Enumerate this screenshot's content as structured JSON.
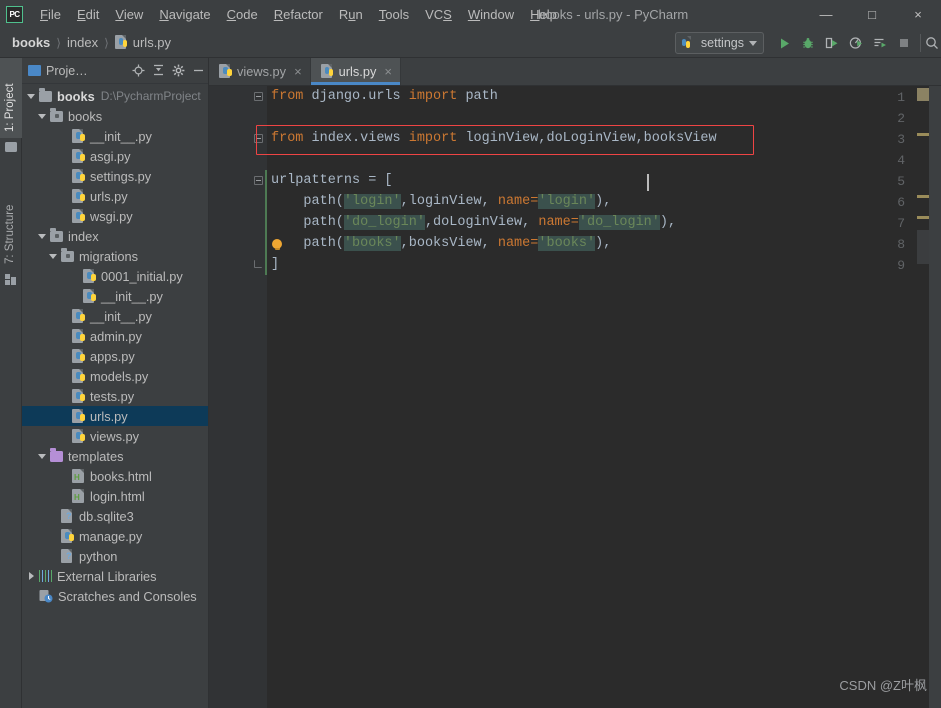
{
  "window": {
    "title": "books - urls.py - PyCharm",
    "app_logo": "pycharm-logo",
    "controls": {
      "minimize": "—",
      "maximize": "□",
      "close": "×"
    }
  },
  "menu": {
    "items": [
      {
        "label": "File",
        "mnemonic": "F"
      },
      {
        "label": "Edit",
        "mnemonic": "E"
      },
      {
        "label": "View",
        "mnemonic": "V"
      },
      {
        "label": "Navigate",
        "mnemonic": "N"
      },
      {
        "label": "Code",
        "mnemonic": "C"
      },
      {
        "label": "Refactor",
        "mnemonic": "R"
      },
      {
        "label": "Run",
        "mnemonic": "u"
      },
      {
        "label": "Tools",
        "mnemonic": "T"
      },
      {
        "label": "VCS",
        "mnemonic": "S"
      },
      {
        "label": "Window",
        "mnemonic": "W"
      },
      {
        "label": "Help",
        "mnemonic": "H"
      }
    ]
  },
  "navbar": {
    "breadcrumbs": [
      {
        "label": "books",
        "bold": true,
        "icon": ""
      },
      {
        "label": "index",
        "bold": false,
        "icon": ""
      },
      {
        "label": "urls.py",
        "bold": false,
        "icon": "python-file-icon"
      }
    ],
    "separator": "〉",
    "run_config": {
      "label": "settings",
      "icon": "python-icon",
      "caret": "chevron-down-icon"
    },
    "buttons": [
      {
        "name": "run-button",
        "icon": "run-icon"
      },
      {
        "name": "debug-button",
        "icon": "debug-bug-icon"
      },
      {
        "name": "run-coverage-button",
        "icon": "coverage-icon"
      },
      {
        "name": "profile-button",
        "icon": "profiler-icon"
      },
      {
        "name": "run-with-console-button",
        "icon": "run-console-icon"
      },
      {
        "name": "stop-button",
        "icon": "stop-square-icon"
      },
      {
        "name": "search-everywhere-button",
        "icon": "search-icon"
      }
    ]
  },
  "left_strip": {
    "tabs": [
      {
        "label": "1: Project",
        "active": true,
        "icon": "project-folder-icon"
      },
      {
        "label": "7: Structure",
        "active": false,
        "icon": "structure-icon"
      }
    ]
  },
  "project_panel": {
    "title": "Proje",
    "title_truncated": "Proje…",
    "header_icons": [
      {
        "name": "select-opened-file-icon",
        "glyph": "target-icon"
      },
      {
        "name": "collapse-all-icon",
        "glyph": "collapse-icon"
      },
      {
        "name": "settings-gear-icon",
        "glyph": "gear-icon"
      },
      {
        "name": "hide-panel-icon",
        "glyph": "minus-icon"
      }
    ],
    "tree": [
      {
        "label": "books",
        "detail": "D:\\PycharmProject",
        "depth": 0,
        "icon": "folder-icon",
        "arrow": "down",
        "bold": true,
        "selected": false
      },
      {
        "label": "books",
        "detail": "",
        "depth": 1,
        "icon": "package-folder-icon",
        "arrow": "down",
        "bold": false,
        "selected": false
      },
      {
        "label": "__init__.py",
        "detail": "",
        "depth": 3,
        "icon": "python-file-icon",
        "arrow": "",
        "bold": false,
        "selected": false
      },
      {
        "label": "asgi.py",
        "detail": "",
        "depth": 3,
        "icon": "python-file-icon",
        "arrow": "",
        "bold": false,
        "selected": false
      },
      {
        "label": "settings.py",
        "detail": "",
        "depth": 3,
        "icon": "python-file-icon",
        "arrow": "",
        "bold": false,
        "selected": false
      },
      {
        "label": "urls.py",
        "detail": "",
        "depth": 3,
        "icon": "python-file-icon",
        "arrow": "",
        "bold": false,
        "selected": false
      },
      {
        "label": "wsgi.py",
        "detail": "",
        "depth": 3,
        "icon": "python-file-icon",
        "arrow": "",
        "bold": false,
        "selected": false
      },
      {
        "label": "index",
        "detail": "",
        "depth": 1,
        "icon": "package-folder-icon",
        "arrow": "down",
        "bold": false,
        "selected": false
      },
      {
        "label": "migrations",
        "detail": "",
        "depth": 2,
        "icon": "package-folder-icon",
        "arrow": "down",
        "bold": false,
        "selected": false
      },
      {
        "label": "0001_initial.py",
        "detail": "",
        "depth": 4,
        "icon": "python-file-icon",
        "arrow": "",
        "bold": false,
        "selected": false
      },
      {
        "label": "__init__.py",
        "detail": "",
        "depth": 4,
        "icon": "python-file-icon",
        "arrow": "",
        "bold": false,
        "selected": false
      },
      {
        "label": "__init__.py",
        "detail": "",
        "depth": 3,
        "icon": "python-file-icon",
        "arrow": "",
        "bold": false,
        "selected": false
      },
      {
        "label": "admin.py",
        "detail": "",
        "depth": 3,
        "icon": "python-file-icon",
        "arrow": "",
        "bold": false,
        "selected": false
      },
      {
        "label": "apps.py",
        "detail": "",
        "depth": 3,
        "icon": "python-file-icon",
        "arrow": "",
        "bold": false,
        "selected": false
      },
      {
        "label": "models.py",
        "detail": "",
        "depth": 3,
        "icon": "python-file-icon",
        "arrow": "",
        "bold": false,
        "selected": false
      },
      {
        "label": "tests.py",
        "detail": "",
        "depth": 3,
        "icon": "python-file-icon",
        "arrow": "",
        "bold": false,
        "selected": false
      },
      {
        "label": "urls.py",
        "detail": "",
        "depth": 3,
        "icon": "python-file-icon",
        "arrow": "",
        "bold": false,
        "selected": true
      },
      {
        "label": "views.py",
        "detail": "",
        "depth": 3,
        "icon": "python-file-icon",
        "arrow": "",
        "bold": false,
        "selected": false
      },
      {
        "label": "templates",
        "detail": "",
        "depth": 1,
        "icon": "templates-folder-icon",
        "arrow": "down",
        "bold": false,
        "selected": false
      },
      {
        "label": "books.html",
        "detail": "",
        "depth": 3,
        "icon": "html-file-icon",
        "arrow": "",
        "bold": false,
        "selected": false
      },
      {
        "label": "login.html",
        "detail": "",
        "depth": 3,
        "icon": "html-file-icon",
        "arrow": "",
        "bold": false,
        "selected": false
      },
      {
        "label": "db.sqlite3",
        "detail": "",
        "depth": 2,
        "icon": "unknown-file-icon",
        "arrow": "",
        "bold": false,
        "selected": false
      },
      {
        "label": "manage.py",
        "detail": "",
        "depth": 2,
        "icon": "python-file-icon",
        "arrow": "",
        "bold": false,
        "selected": false
      },
      {
        "label": "python",
        "detail": "",
        "depth": 2,
        "icon": "unknown-file-icon",
        "arrow": "",
        "bold": false,
        "selected": false
      },
      {
        "label": "External Libraries",
        "detail": "",
        "depth": 0,
        "icon": "library-icon",
        "arrow": "right",
        "bold": false,
        "selected": false
      },
      {
        "label": "Scratches and Consoles",
        "detail": "",
        "depth": 0,
        "icon": "scratches-icon",
        "arrow": "",
        "bold": false,
        "selected": false
      }
    ]
  },
  "editor": {
    "tabs": [
      {
        "label": "views.py",
        "active": false,
        "icon": "python-file-icon",
        "close": "×"
      },
      {
        "label": "urls.py",
        "active": true,
        "icon": "python-file-icon",
        "close": "×"
      }
    ],
    "line_numbers": [
      "1",
      "2",
      "3",
      "4",
      "5",
      "6",
      "7",
      "8",
      "9"
    ],
    "lines": [
      {
        "n": 1,
        "segments": [
          {
            "t": "from ",
            "c": "k"
          },
          {
            "t": "django.urls ",
            "c": "id"
          },
          {
            "t": "import ",
            "c": "k"
          },
          {
            "t": "path",
            "c": "id"
          }
        ]
      },
      {
        "n": 2,
        "segments": []
      },
      {
        "n": 3,
        "segments": [
          {
            "t": "from ",
            "c": "k"
          },
          {
            "t": "index.views ",
            "c": "id"
          },
          {
            "t": "import ",
            "c": "k"
          },
          {
            "t": "loginView,doLoginView,booksView",
            "c": "id"
          }
        ]
      },
      {
        "n": 4,
        "segments": []
      },
      {
        "n": 5,
        "segments": [
          {
            "t": "urlpatterns = ",
            "c": "id"
          },
          {
            "t": "[",
            "c": "br"
          }
        ]
      },
      {
        "n": 6,
        "segments": [
          {
            "t": "    path(",
            "c": "id"
          },
          {
            "t": "'login'",
            "c": "s"
          },
          {
            "t": ",loginView, ",
            "c": "id"
          },
          {
            "t": "name=",
            "c": "nm-arg"
          },
          {
            "t": "'login'",
            "c": "s"
          },
          {
            "t": "),",
            "c": "id"
          }
        ]
      },
      {
        "n": 7,
        "segments": [
          {
            "t": "    path(",
            "c": "id"
          },
          {
            "t": "'do_login'",
            "c": "s"
          },
          {
            "t": ",doLoginView, ",
            "c": "id"
          },
          {
            "t": "name=",
            "c": "nm-arg"
          },
          {
            "t": "'do_login'",
            "c": "s"
          },
          {
            "t": "),",
            "c": "id"
          }
        ]
      },
      {
        "n": 8,
        "segments": [
          {
            "t": "    path(",
            "c": "id"
          },
          {
            "t": "'books'",
            "c": "s"
          },
          {
            "t": ",booksView, ",
            "c": "id"
          },
          {
            "t": "name=",
            "c": "nm-arg"
          },
          {
            "t": "'books'",
            "c": "s"
          },
          {
            "t": "),",
            "c": "id"
          }
        ]
      },
      {
        "n": 9,
        "segments": [
          {
            "t": "]",
            "c": "br"
          }
        ]
      }
    ],
    "annotation": {
      "name": "red-highlight-box",
      "target_line": 3,
      "color": "#ee4444"
    },
    "intention_bulb": {
      "line": 8,
      "icon": "lightbulb-icon"
    },
    "marker_color": "#9a8c5a"
  },
  "watermark": {
    "text": "CSDN @Z叶枫"
  },
  "colors": {
    "background": "#3c3f41",
    "editor_bg": "#2b2b2b",
    "gutter_bg": "#313335",
    "keyword": "#cc7832",
    "identifier": "#a9b7c6",
    "string": "#6a8759",
    "selection": "#0d3a58",
    "tab_underline": "#4a88c7",
    "annotation": "#ee4444"
  }
}
